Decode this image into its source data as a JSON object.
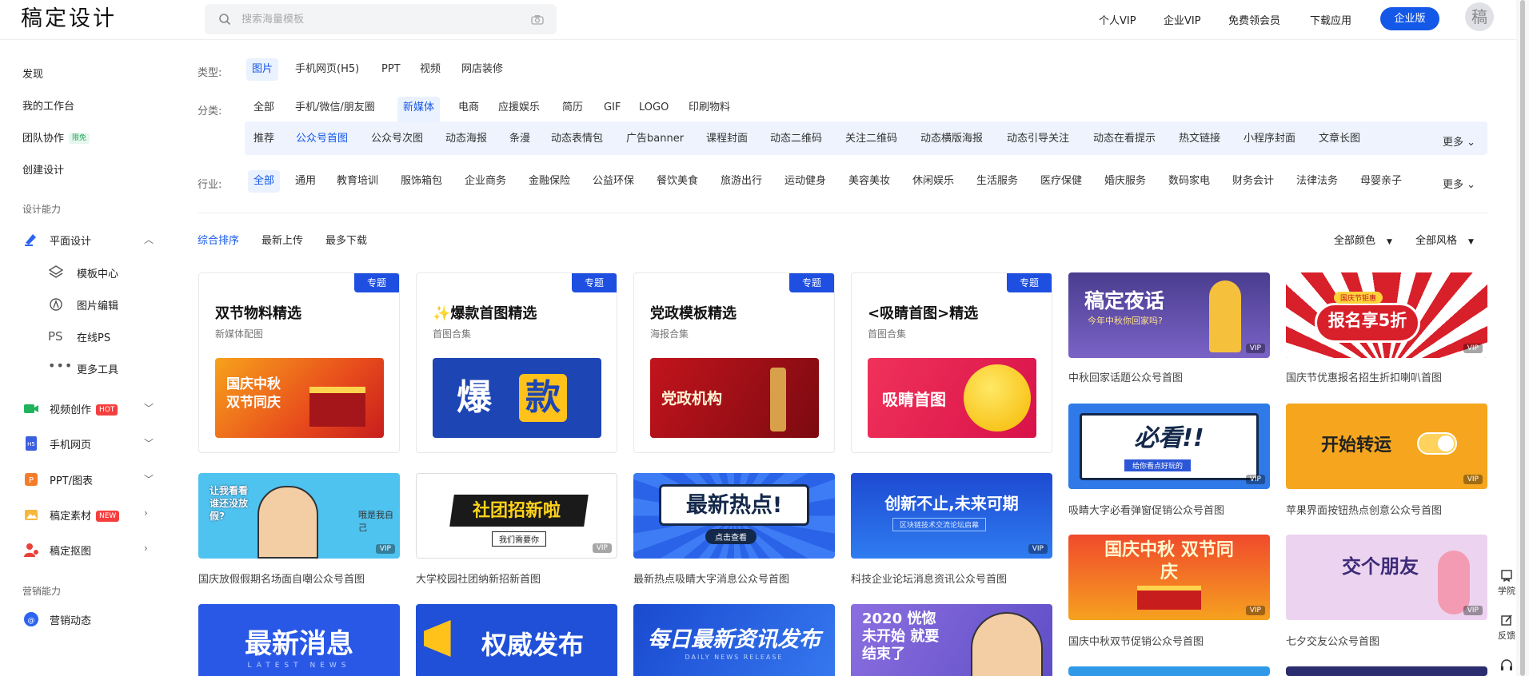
{
  "header": {
    "logo": "稿定设计",
    "search_placeholder": "搜索海量模板",
    "nav": [
      "个人VIP",
      "企业VIP",
      "免费领会员",
      "下载应用"
    ],
    "enterprise_button": "企业版",
    "avatar": "稿"
  },
  "sidebar": {
    "top_items": [
      "发现",
      "我的工作台",
      "团队协作",
      "创建设计"
    ],
    "team_tag": "限免",
    "section_design": "设计能力",
    "graphic": "平面设计",
    "graphic_sub": [
      "模板中心",
      "图片编辑",
      "在线PS",
      "更多工具"
    ],
    "video": "视频创作",
    "video_tag": "HOT",
    "h5": "手机网页",
    "ppt": "PPT/图表",
    "material": "稿定素材",
    "material_tag": "NEW",
    "cutout": "稿定抠图",
    "section_marketing": "营销能力",
    "marketing": "营销动态"
  },
  "filters": {
    "type_label": "类型:",
    "types": [
      "图片",
      "手机网页(H5)",
      "PPT",
      "视频",
      "网店装修"
    ],
    "category_label": "分类:",
    "categories": [
      "全部",
      "手机/微信/朋友圈",
      "新媒体",
      "电商",
      "应援娱乐",
      "简历",
      "GIF",
      "LOGO",
      "印刷物料"
    ],
    "subcategories": [
      "推荐",
      "公众号首图",
      "公众号次图",
      "动态海报",
      "条漫",
      "动态表情包",
      "广告banner",
      "课程封面",
      "动态二维码",
      "关注二维码",
      "动态横版海报",
      "动态引导关注",
      "动态在看提示",
      "热文链接",
      "小程序封面",
      "文章长图"
    ],
    "more": "更多",
    "industry_label": "行业:",
    "industries": [
      "全部",
      "通用",
      "教育培训",
      "服饰箱包",
      "企业商务",
      "金融保险",
      "公益环保",
      "餐饮美食",
      "旅游出行",
      "运动健身",
      "美容美妆",
      "休闲娱乐",
      "生活服务",
      "医疗保健",
      "婚庆服务",
      "数码家电",
      "财务会计",
      "法律法务",
      "母婴亲子"
    ]
  },
  "sort": {
    "options": [
      "综合排序",
      "最新上传",
      "最多下载"
    ],
    "color": "全部颜色",
    "style": "全部风格"
  },
  "collections": [
    {
      "badge": "专题",
      "title": "双节物料精选",
      "subtitle": "新媒体配图",
      "img_text": "国庆中秋 双节同庆"
    },
    {
      "badge": "专题",
      "title": "✨爆款首图精选",
      "subtitle": "首图合集",
      "img_text1": "爆",
      "img_text2": "款"
    },
    {
      "badge": "专题",
      "title": "党政模板精选",
      "subtitle": "海报合集",
      "img_text": "党政机构"
    },
    {
      "badge": "专题",
      "title": "<吸睛首图>精选",
      "subtitle": "首图合集",
      "img_text": "吸睛首图"
    }
  ],
  "templates": [
    {
      "caption": "中秋回家话题公众号首图",
      "img": "稿定夜话",
      "img_sub": "今年中秋你回家吗?"
    },
    {
      "caption": "国庆节优惠报名招生折扣喇叭首图",
      "img": "报名享5折",
      "img_sub": "国庆节钜惠"
    },
    {
      "caption": "国庆放假假期名场面自嘲公众号首图",
      "img": "让我看看 谁还没放假?",
      "img_sub": "哦是我自己"
    },
    {
      "caption": "大学校园社团纳新招新首图",
      "img": "社团招新啦",
      "img_sub": "我们需要你"
    },
    {
      "caption": "最新热点吸睛大字消息公众号首图",
      "img": "最新热点!",
      "img_sub": "点击查看"
    },
    {
      "caption": "科技企业论坛消息资讯公众号首图",
      "img": "创新不止,未来可期",
      "img_sub": "区块链技术交流论坛启幕"
    },
    {
      "caption": "吸睛大字必看弹窗促销公众号首图",
      "img": "必看!!",
      "img_sub": "给你看点好玩的"
    },
    {
      "caption": "苹果界面按钮热点创意公众号首图",
      "img": "开始转运"
    },
    {
      "caption": "国庆中秋双节促销公众号首图",
      "img": "国庆中秋 双节同庆"
    },
    {
      "caption": "七夕交友公众号首图",
      "img": "交个朋友"
    },
    {
      "caption": "",
      "img": "最新消息",
      "img_sub": "LATEST NEWS"
    },
    {
      "caption": "",
      "img": "权威发布"
    },
    {
      "caption": "",
      "img": "每日最新资讯发布",
      "img_sub": "DAILY NEWS RELEASE"
    },
    {
      "caption": "",
      "img": "2020 恍惚未开始 就要结束了"
    }
  ],
  "vip": "VIP",
  "right_tools": [
    "学院",
    "反馈"
  ],
  "colors": {
    "accent": "#1458e8",
    "badge": "#1e4fe0"
  }
}
